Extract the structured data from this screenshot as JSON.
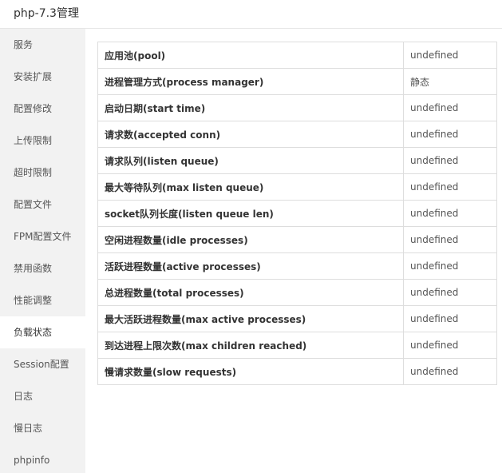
{
  "window": {
    "title": "php-7.3管理"
  },
  "sidebar": {
    "items": [
      {
        "label": "服务",
        "active": false
      },
      {
        "label": "安装扩展",
        "active": false
      },
      {
        "label": "配置修改",
        "active": false
      },
      {
        "label": "上传限制",
        "active": false
      },
      {
        "label": "超时限制",
        "active": false
      },
      {
        "label": "配置文件",
        "active": false
      },
      {
        "label": "FPM配置文件",
        "active": false
      },
      {
        "label": "禁用函数",
        "active": false
      },
      {
        "label": "性能调整",
        "active": false
      },
      {
        "label": "负载状态",
        "active": true
      },
      {
        "label": "Session配置",
        "active": false
      },
      {
        "label": "日志",
        "active": false
      },
      {
        "label": "慢日志",
        "active": false
      },
      {
        "label": "phpinfo",
        "active": false
      }
    ]
  },
  "status_table": {
    "rows": [
      {
        "key": "应用池(pool)",
        "value": "undefined"
      },
      {
        "key": "进程管理方式(process manager)",
        "value": "静态"
      },
      {
        "key": "启动日期(start time)",
        "value": "undefined"
      },
      {
        "key": "请求数(accepted conn)",
        "value": "undefined"
      },
      {
        "key": "请求队列(listen queue)",
        "value": "undefined"
      },
      {
        "key": "最大等待队列(max listen queue)",
        "value": "undefined"
      },
      {
        "key": "socket队列长度(listen queue len)",
        "value": "undefined"
      },
      {
        "key": "空闲进程数量(idle processes)",
        "value": "undefined"
      },
      {
        "key": "活跃进程数量(active processes)",
        "value": "undefined"
      },
      {
        "key": "总进程数量(total processes)",
        "value": "undefined"
      },
      {
        "key": "最大活跃进程数量(max active processes)",
        "value": "undefined"
      },
      {
        "key": "到达进程上限次数(max children reached)",
        "value": "undefined"
      },
      {
        "key": "慢请求数量(slow requests)",
        "value": "undefined"
      }
    ]
  }
}
